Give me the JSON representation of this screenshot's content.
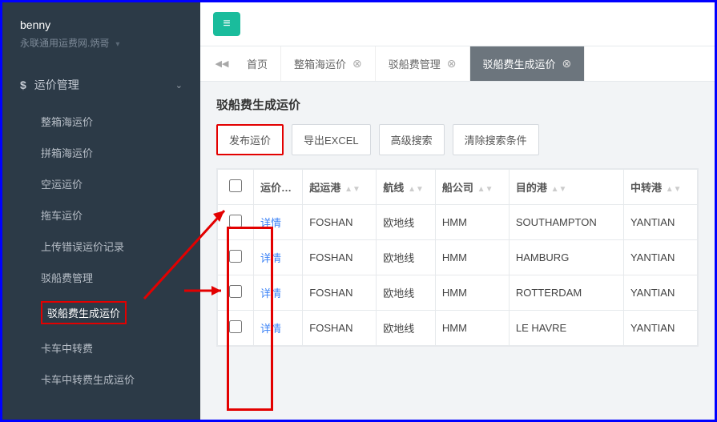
{
  "user": {
    "name": "benny",
    "info": "永联通用运费网.炳哥"
  },
  "nav": {
    "section_title": "运价管理",
    "items": [
      "整箱海运价",
      "拼箱海运价",
      "空运运价",
      "拖车运价",
      "上传错误运价记录",
      "驳船费管理",
      "驳船费生成运价",
      "卡车中转费",
      "卡车中转费生成运价"
    ],
    "active_index": 6
  },
  "tabs": {
    "items": [
      {
        "label": "首页",
        "closable": false
      },
      {
        "label": "整箱海运价",
        "closable": true
      },
      {
        "label": "驳船费管理",
        "closable": true
      },
      {
        "label": "驳船费生成运价",
        "closable": true
      }
    ],
    "active_index": 3
  },
  "panel_title": "驳船费生成运价",
  "buttons": {
    "publish": "发布运价",
    "export": "导出EXCEL",
    "adv_search": "高级搜索",
    "clear": "清除搜索条件"
  },
  "table": {
    "headers": [
      "运价详情",
      "起运港",
      "航线",
      "船公司",
      "目的港",
      "中转港"
    ],
    "rows": [
      {
        "detail": "详情",
        "origin": "FOSHAN",
        "route": "欧地线",
        "carrier": "HMM",
        "dest": "SOUTHAMPTON",
        "transit": "YANTIAN"
      },
      {
        "detail": "详情",
        "origin": "FOSHAN",
        "route": "欧地线",
        "carrier": "HMM",
        "dest": "HAMBURG",
        "transit": "YANTIAN"
      },
      {
        "detail": "详情",
        "origin": "FOSHAN",
        "route": "欧地线",
        "carrier": "HMM",
        "dest": "ROTTERDAM",
        "transit": "YANTIAN"
      },
      {
        "detail": "详情",
        "origin": "FOSHAN",
        "route": "欧地线",
        "carrier": "HMM",
        "dest": "LE HAVRE",
        "transit": "YANTIAN"
      }
    ]
  }
}
